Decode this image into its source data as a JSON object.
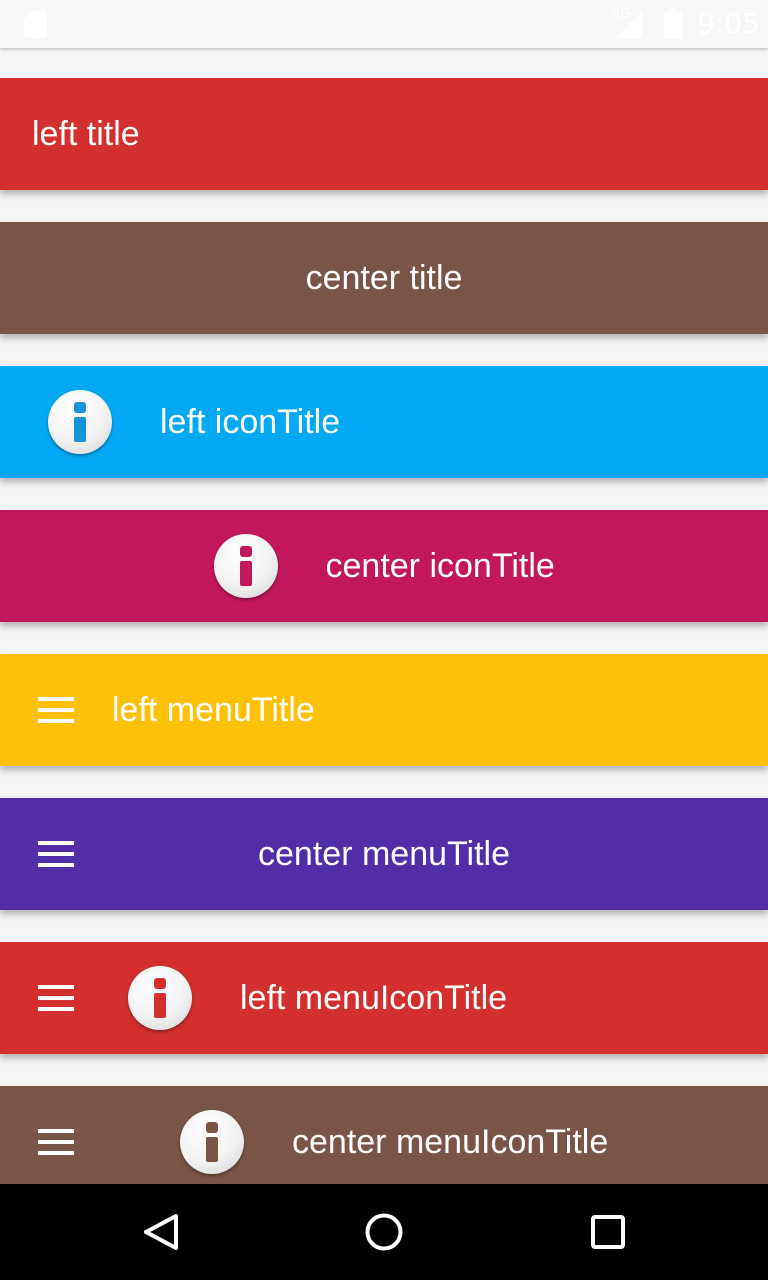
{
  "status_bar": {
    "network_type": "3G",
    "time": "9:05",
    "icons": [
      "sd-card-icon",
      "signal-icon",
      "battery-icon"
    ]
  },
  "toolbars": [
    {
      "name": "left-title-bar",
      "title": "left title",
      "align": "left",
      "has_menu": false,
      "has_icon": false,
      "color": "#d32f2f"
    },
    {
      "name": "center-title-bar",
      "title": "center title",
      "align": "center",
      "has_menu": false,
      "has_icon": false,
      "color": "#795548"
    },
    {
      "name": "left-icon-title-bar",
      "title": "left iconTitle",
      "align": "left",
      "has_menu": false,
      "has_icon": true,
      "color": "#03a9f4",
      "icon_color": "#1793d9"
    },
    {
      "name": "center-icon-title-bar",
      "title": "center iconTitle",
      "align": "center",
      "has_menu": false,
      "has_icon": true,
      "color": "#c2185b",
      "icon_color": "#c2185b"
    },
    {
      "name": "left-menu-title-bar",
      "title": "left menuTitle",
      "align": "left",
      "has_menu": true,
      "has_icon": false,
      "color": "#ffc107"
    },
    {
      "name": "center-menu-title-bar",
      "title": "center menuTitle",
      "align": "center",
      "has_menu": true,
      "has_icon": false,
      "color": "#512da8"
    },
    {
      "name": "left-menu-icon-title-bar",
      "title": "left menuIconTitle",
      "align": "left",
      "has_menu": true,
      "has_icon": true,
      "color": "#d32f2f",
      "icon_color": "#d32f2f"
    },
    {
      "name": "center-menu-icon-title-bar",
      "title": "center menuIconTitle",
      "align": "center",
      "has_menu": true,
      "has_icon": true,
      "color": "#795548",
      "icon_color": "#795548"
    }
  ],
  "nav_bar": {
    "buttons": [
      "back-icon",
      "home-icon",
      "recents-icon"
    ],
    "color": "#000000"
  }
}
